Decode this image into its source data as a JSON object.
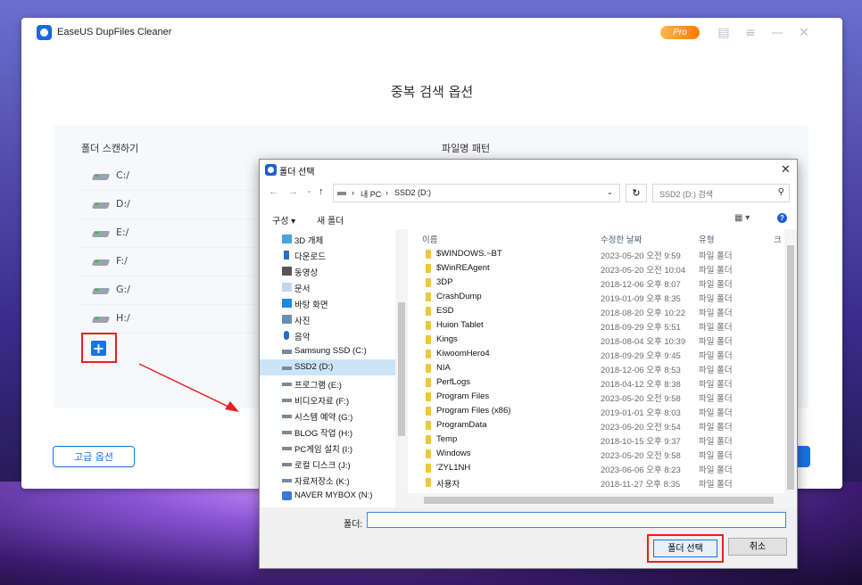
{
  "app": {
    "title": "EaseUS DupFiles Cleaner",
    "pro_badge": "Pro",
    "page_title": "중복 검색 옵션",
    "scan_folders_label": "폴더 스캔하기",
    "file_pattern_label": "파일명 패턴",
    "drives": [
      "C:/",
      "D:/",
      "E:/",
      "F:/",
      "G:/",
      "H:/"
    ],
    "add_button": "+",
    "advanced_button": "고급 옵션",
    "colors": {
      "accent": "#1a73e8",
      "highlight": "#e8201f"
    }
  },
  "dialog": {
    "title": "폴더 선택",
    "breadcrumb": [
      "내 PC",
      "SSD2 (D:)"
    ],
    "search_placeholder": "SSD2 (D:) 검색",
    "toolbar": {
      "organize": "구성 ▾",
      "new_folder": "새 폴더"
    },
    "nav_items": [
      {
        "label": "3D 개체",
        "icon": "3d-objects-icon"
      },
      {
        "label": "다운로드",
        "icon": "download-icon"
      },
      {
        "label": "동영상",
        "icon": "video-icon"
      },
      {
        "label": "문서",
        "icon": "document-icon"
      },
      {
        "label": "바탕 화면",
        "icon": "desktop-icon"
      },
      {
        "label": "사진",
        "icon": "pictures-icon"
      },
      {
        "label": "음악",
        "icon": "music-icon"
      },
      {
        "label": "Samsung SSD (C:)",
        "icon": "drive-icon"
      },
      {
        "label": "SSD2 (D:)",
        "icon": "drive-icon",
        "selected": true
      },
      {
        "label": "프로그램 (E:)",
        "icon": "drive-icon"
      },
      {
        "label": "비디오자료 (F:)",
        "icon": "drive-icon"
      },
      {
        "label": "시스템 예약 (G:)",
        "icon": "drive-icon"
      },
      {
        "label": "BLOG 작업 (H:)",
        "icon": "drive-icon"
      },
      {
        "label": "PC게임 설치 (I:)",
        "icon": "drive-icon"
      },
      {
        "label": "로컬 디스크 (J:)",
        "icon": "drive-icon"
      },
      {
        "label": "자료저장소 (K:)",
        "icon": "drive-icon"
      },
      {
        "label": "NAVER MYBOX (N:)",
        "icon": "cloud-drive-icon"
      }
    ],
    "columns": {
      "name": "이름",
      "modified": "수정한 날짜",
      "type": "유형",
      "size": "크"
    },
    "files": [
      {
        "name": "$WINDOWS.~BT",
        "date": "2023-05-20 오전 9:59",
        "type": "파일 폴더"
      },
      {
        "name": "$WinREAgent",
        "date": "2023-05-20 오전 10:04",
        "type": "파일 폴더"
      },
      {
        "name": "3DP",
        "date": "2018-12-06 오후 8:07",
        "type": "파일 폴더"
      },
      {
        "name": "CrashDump",
        "date": "2019-01-09 오후 8:35",
        "type": "파일 폴더"
      },
      {
        "name": "ESD",
        "date": "2018-08-20 오후 10:22",
        "type": "파일 폴더"
      },
      {
        "name": "Huion Tablet",
        "date": "2018-09-29 오후 5:51",
        "type": "파일 폴더"
      },
      {
        "name": "Kings",
        "date": "2018-08-04 오후 10:39",
        "type": "파일 폴더"
      },
      {
        "name": "KiwoomHero4",
        "date": "2018-09-29 오후 9:45",
        "type": "파일 폴더"
      },
      {
        "name": "NIA",
        "date": "2018-12-06 오후 8:53",
        "type": "파일 폴더"
      },
      {
        "name": "PerfLogs",
        "date": "2018-04-12 오후 8:38",
        "type": "파일 폴더"
      },
      {
        "name": "Program Files",
        "date": "2023-05-20 오전 9:58",
        "type": "파일 폴더"
      },
      {
        "name": "Program Files (x86)",
        "date": "2019-01-01 오후 8:03",
        "type": "파일 폴더"
      },
      {
        "name": "ProgramData",
        "date": "2023-05-20 오전 9:54",
        "type": "파일 폴더"
      },
      {
        "name": "Temp",
        "date": "2018-10-15 오후 9:37",
        "type": "파일 폴더"
      },
      {
        "name": "Windows",
        "date": "2023-05-20 오전 9:58",
        "type": "파일 폴더"
      },
      {
        "name": "'ZYL1NH",
        "date": "2023-06-06 오후 8:23",
        "type": "파일 폴더"
      },
      {
        "name": "사용자",
        "date": "2018-11-27 오후 8:35",
        "type": "파일 폴더"
      }
    ],
    "folder_label": "폴더:",
    "folder_value": "",
    "select_button": "폴더 선택",
    "cancel_button": "취소"
  }
}
